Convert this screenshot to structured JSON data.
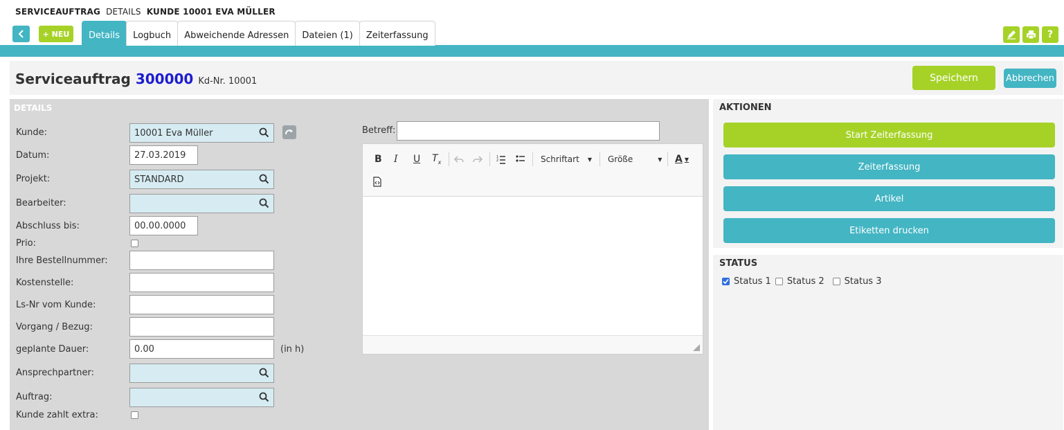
{
  "breadcrumb": {
    "part1": "SERVICEAUFTRAG",
    "part2": "DETAILS",
    "part3": "KUNDE 10001 EVA MÜLLER"
  },
  "toolbar": {
    "new_label": "+ NEU"
  },
  "tabs": [
    {
      "label": "Details",
      "active": true
    },
    {
      "label": "Logbuch"
    },
    {
      "label": "Abweichende Adressen"
    },
    {
      "label": "Dateien (1)"
    },
    {
      "label": "Zeiterfassung"
    }
  ],
  "header": {
    "title": "Serviceauftrag",
    "number": "300000",
    "customer_no": "Kd-Nr. 10001",
    "save_label": "Speichern",
    "cancel_label": "Abbrechen"
  },
  "details": {
    "section_title": "DETAILS",
    "fields": {
      "kunde": {
        "label": "Kunde:",
        "value": "10001 Eva Müller"
      },
      "datum": {
        "label": "Datum:",
        "value": "27.03.2019"
      },
      "projekt": {
        "label": "Projekt:",
        "value": "STANDARD"
      },
      "bearbeiter": {
        "label": "Bearbeiter:",
        "value": ""
      },
      "abschluss": {
        "label": "Abschluss bis:",
        "value": "00.00.0000"
      },
      "prio": {
        "label": "Prio:",
        "checked": false
      },
      "bestellnummer": {
        "label": "Ihre Bestellnummer:",
        "value": ""
      },
      "kostenstelle": {
        "label": "Kostenstelle:",
        "value": ""
      },
      "lsnr": {
        "label": "Ls-Nr vom Kunde:",
        "value": ""
      },
      "vorgang": {
        "label": "Vorgang / Bezug:",
        "value": ""
      },
      "dauer": {
        "label": "geplante Dauer:",
        "value": "0.00",
        "unit": "(in h)"
      },
      "ansprechpartner": {
        "label": "Ansprechpartner:",
        "value": ""
      },
      "auftrag": {
        "label": "Auftrag:",
        "value": ""
      },
      "extra": {
        "label": "Kunde zahlt extra:",
        "checked": false
      }
    },
    "betreff": {
      "label": "Betreff:",
      "value": ""
    },
    "editor": {
      "font_label": "Schriftart",
      "size_label": "Größe"
    }
  },
  "aktionen": {
    "title": "AKTIONEN",
    "buttons": [
      "Start Zeiterfassung",
      "Zeiterfassung",
      "Artikel",
      "Etiketten drucken"
    ]
  },
  "status": {
    "title": "STATUS",
    "items": [
      {
        "label": "Status 1",
        "checked": true
      },
      {
        "label": "Status 2",
        "checked": false
      },
      {
        "label": "Status 3",
        "checked": false
      }
    ]
  },
  "colors": {
    "teal": "#43b5c3",
    "green": "#a6d228",
    "number_blue": "#1d1dcf"
  }
}
